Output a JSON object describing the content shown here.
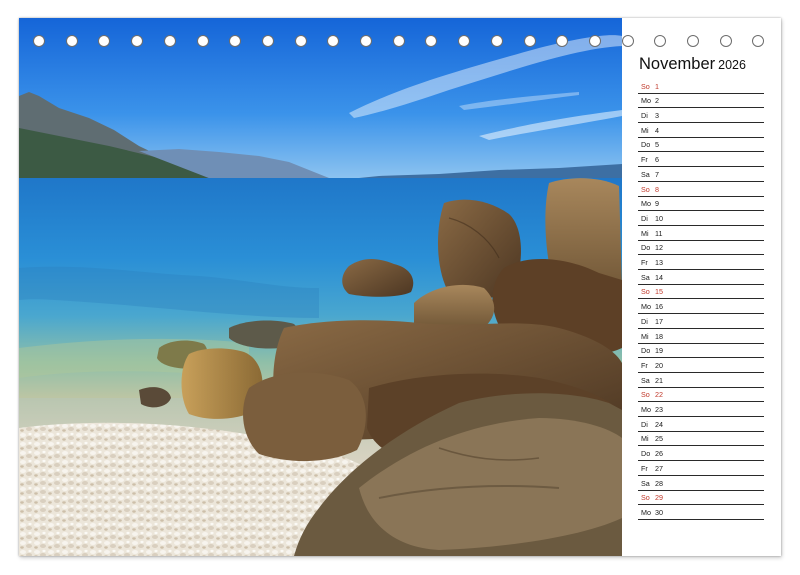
{
  "calendar": {
    "month": "November",
    "year": "2026",
    "days": [
      {
        "wd": "So",
        "d": "1",
        "sunday": true
      },
      {
        "wd": "Mo",
        "d": "2"
      },
      {
        "wd": "Di",
        "d": "3"
      },
      {
        "wd": "Mi",
        "d": "4"
      },
      {
        "wd": "Do",
        "d": "5"
      },
      {
        "wd": "Fr",
        "d": "6"
      },
      {
        "wd": "Sa",
        "d": "7"
      },
      {
        "wd": "So",
        "d": "8",
        "sunday": true
      },
      {
        "wd": "Mo",
        "d": "9"
      },
      {
        "wd": "Di",
        "d": "10"
      },
      {
        "wd": "Mi",
        "d": "11"
      },
      {
        "wd": "Do",
        "d": "12"
      },
      {
        "wd": "Fr",
        "d": "13"
      },
      {
        "wd": "Sa",
        "d": "14"
      },
      {
        "wd": "So",
        "d": "15",
        "sunday": true
      },
      {
        "wd": "Mo",
        "d": "16"
      },
      {
        "wd": "Di",
        "d": "17"
      },
      {
        "wd": "Mi",
        "d": "18"
      },
      {
        "wd": "Do",
        "d": "19"
      },
      {
        "wd": "Fr",
        "d": "20"
      },
      {
        "wd": "Sa",
        "d": "21"
      },
      {
        "wd": "So",
        "d": "22",
        "sunday": true
      },
      {
        "wd": "Mo",
        "d": "23"
      },
      {
        "wd": "Di",
        "d": "24"
      },
      {
        "wd": "Mi",
        "d": "25"
      },
      {
        "wd": "Do",
        "d": "26"
      },
      {
        "wd": "Fr",
        "d": "27"
      },
      {
        "wd": "Sa",
        "d": "28"
      },
      {
        "wd": "So",
        "d": "29",
        "sunday": true
      },
      {
        "wd": "Mo",
        "d": "30"
      }
    ]
  },
  "colors": {
    "sunday": "#c0392b",
    "text": "#1a1a1a",
    "sky": "#2f86e0",
    "sea": "#2d8fd2"
  }
}
